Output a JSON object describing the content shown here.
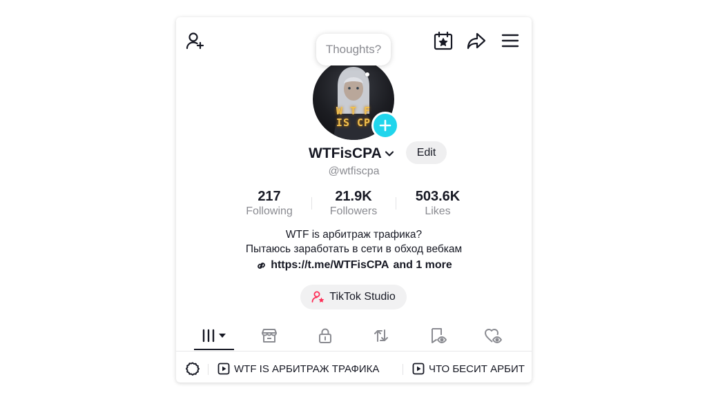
{
  "header": {
    "icons": [
      "add-friend-icon",
      "calendar-star-icon",
      "share-arrow-icon",
      "menu-icon"
    ],
    "thought_bubble": "Thoughts?"
  },
  "profile": {
    "avatar_text_line1": "W T F",
    "avatar_text_line2": "IS CP",
    "username": "WTFisCPA",
    "edit_label": "Edit",
    "handle": "@wtfiscpa"
  },
  "stats": [
    {
      "value": "217",
      "label": "Following"
    },
    {
      "value": "21.9K",
      "label": "Followers"
    },
    {
      "value": "503.6K",
      "label": "Likes"
    }
  ],
  "bio": {
    "line1": "WTF is арбитраж трафика?",
    "line2": "Пытаюсь заработать в сети в обход вебкам",
    "link": "https://t.me/WTFisCPA",
    "more": "and 1 more"
  },
  "studio_button": "TikTok Studio",
  "tabs": [
    "videos-grid-icon",
    "shop-icon",
    "lock-icon",
    "repost-icon",
    "favorites-icon",
    "liked-icon"
  ],
  "playlists": [
    {
      "title": "WTF IS АРБИТРАЖ ТРАФИКА"
    },
    {
      "title": "ЧТО БЕСИТ АРБИТ"
    }
  ],
  "colors": {
    "accent_cyan": "#20d5ec",
    "studio_pink": "#fe2c55",
    "text_primary": "#161823",
    "text_secondary": "#8a8b91"
  }
}
